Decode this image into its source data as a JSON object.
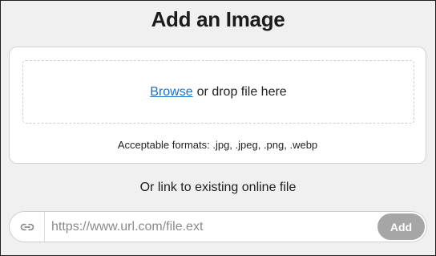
{
  "dialog": {
    "title": "Add an Image"
  },
  "upload": {
    "browse_label": "Browse",
    "drop_text": "or drop file here",
    "formats_text": "Acceptable formats: .jpg, .jpeg, .png, .webp"
  },
  "link": {
    "label": "Or link to existing online file",
    "url_placeholder": "https://www.url.com/file.ext",
    "url_value": "",
    "add_label": "Add",
    "icon": "link-icon"
  },
  "colors": {
    "background": "#f0f0f0",
    "link": "#1a73c8",
    "add_button_disabled": "#a6a6a6"
  }
}
